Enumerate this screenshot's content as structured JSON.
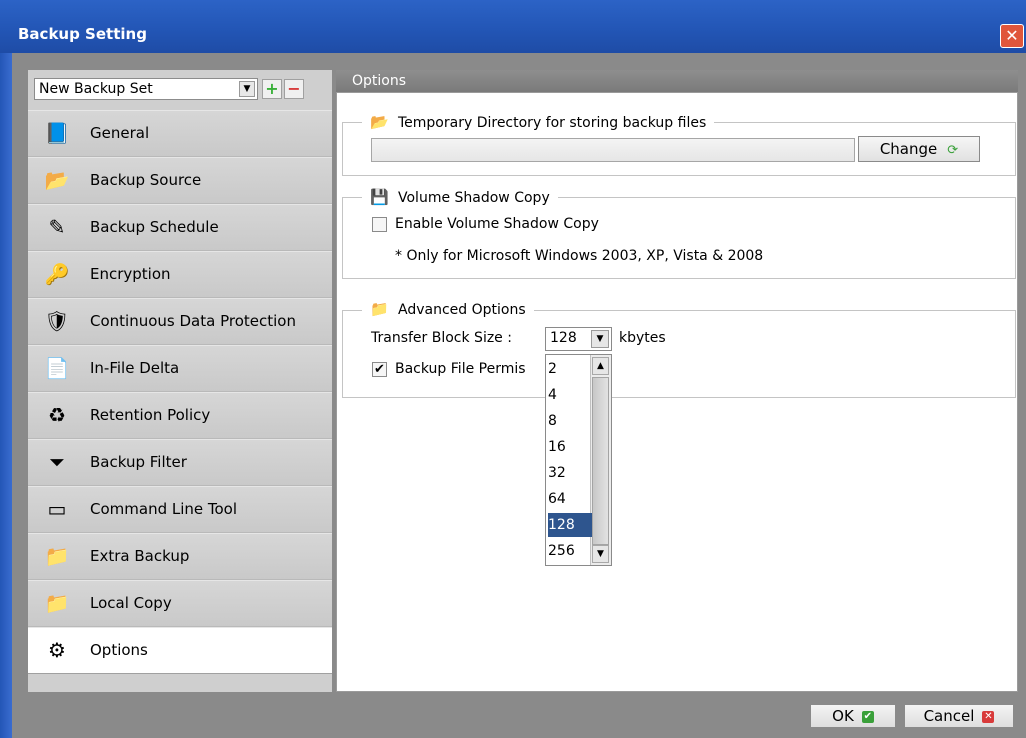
{
  "window": {
    "title": "Backup Setting"
  },
  "sidebar": {
    "backup_set": "New Backup Set",
    "items": [
      {
        "label": "General",
        "icon": "general-icon",
        "glyph": "📘"
      },
      {
        "label": "Backup Source",
        "icon": "folder-icon",
        "glyph": "📂"
      },
      {
        "label": "Backup Schedule",
        "icon": "schedule-icon",
        "glyph": "✎"
      },
      {
        "label": "Encryption",
        "icon": "encryption-icon",
        "glyph": "🔑"
      },
      {
        "label": "Continuous Data Protection",
        "icon": "shield-icon",
        "glyph": "🛡"
      },
      {
        "label": "In-File Delta",
        "icon": "file-delta-icon",
        "glyph": "📄"
      },
      {
        "label": "Retention Policy",
        "icon": "recycle-bin-icon",
        "glyph": "♻"
      },
      {
        "label": "Backup Filter",
        "icon": "filter-icon",
        "glyph": "⏷"
      },
      {
        "label": "Command Line Tool",
        "icon": "command-line-icon",
        "glyph": "▭"
      },
      {
        "label": "Extra Backup",
        "icon": "extra-backup-icon",
        "glyph": "📁"
      },
      {
        "label": "Local Copy",
        "icon": "local-copy-icon",
        "glyph": "📁"
      },
      {
        "label": "Options",
        "icon": "options-gear-icon",
        "glyph": "⚙"
      }
    ],
    "active": "Options"
  },
  "panel": {
    "header": "Options",
    "temp_dir": {
      "legend": "Temporary Directory for storing backup files",
      "path_value": "",
      "change_label": "Change"
    },
    "vss": {
      "legend": "Volume Shadow Copy",
      "enable_label": "Enable Volume Shadow Copy",
      "enabled": false,
      "note": "* Only for Microsoft Windows 2003, XP, Vista & 2008"
    },
    "advanced": {
      "legend": "Advanced Options",
      "block_size_label": "Transfer Block Size :",
      "block_size_value": "128",
      "block_size_unit": "kbytes",
      "block_size_options": [
        "2",
        "4",
        "8",
        "16",
        "32",
        "64",
        "128",
        "256"
      ],
      "permission_label": "Backup File Permis",
      "permission_checked": true
    }
  },
  "footer": {
    "ok_label": "OK",
    "cancel_label": "Cancel"
  },
  "colors": {
    "title_bar": "#2356b6",
    "selected_option": "#2e558e",
    "ok_badge": "#3aa03a",
    "cancel_badge": "#d83a3a"
  }
}
